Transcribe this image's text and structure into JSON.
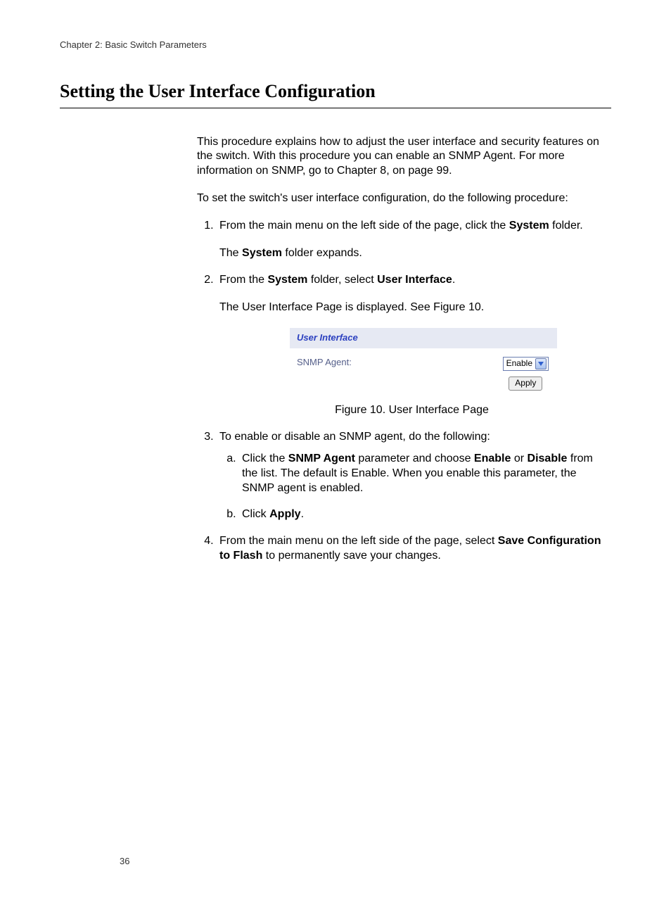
{
  "header": {
    "chapter_line": "Chapter 2: Basic Switch Parameters"
  },
  "title": "Setting the User Interface Configuration",
  "intro": {
    "p1": "This procedure explains how to adjust the user interface and security features on the switch. With this procedure you can enable an SNMP Agent. For more information on SNMP, go to Chapter 8, on page 99.",
    "p2": "To set the switch's user interface configuration, do the following procedure:"
  },
  "steps": {
    "s1a": "From the main menu on the left side of the page, click the ",
    "s1b": "System",
    "s1c": " folder.",
    "s1_r_a": "The ",
    "s1_r_b": "System",
    "s1_r_c": " folder expands.",
    "s2a": "From the ",
    "s2b": "System",
    "s2c": " folder, select ",
    "s2d": "User Interface",
    "s2e": ".",
    "s2_r": "The User Interface Page is displayed. See Figure 10.",
    "s3": "To enable or disable an SNMP agent, do the following:",
    "s3a_1": "Click the ",
    "s3a_2": "SNMP Agent",
    "s3a_3": " parameter and choose ",
    "s3a_4": "Enable",
    "s3a_5": " or ",
    "s3a_6": "Disable",
    "s3a_7": " from the list. The default is Enable. When you enable this parameter, the SNMP agent is enabled.",
    "s3b_1": "Click ",
    "s3b_2": "Apply",
    "s3b_3": ".",
    "s4a": "From the main menu on the left side of the page, select ",
    "s4b": "Save Configuration to Flash",
    "s4c": " to permanently save your changes."
  },
  "figure": {
    "panel_title": "User Interface",
    "row_label": "SNMP Agent:",
    "dropdown_value": "Enable",
    "apply_label": "Apply",
    "caption": "Figure 10. User Interface Page"
  },
  "footer": {
    "page_number": "36"
  }
}
